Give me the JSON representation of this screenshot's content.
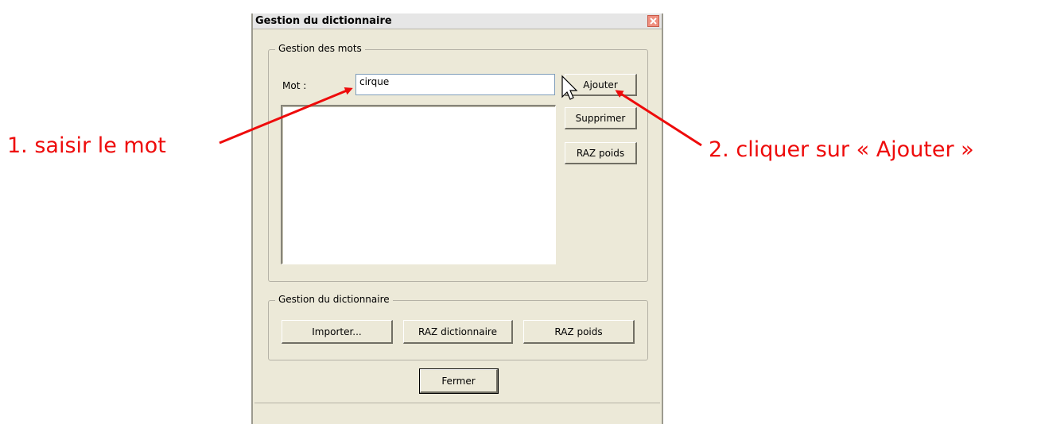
{
  "window": {
    "title": "Gestion du dictionnaire"
  },
  "words_group": {
    "legend": "Gestion des mots",
    "mot_label": "Mot :",
    "mot_value": "cirque",
    "buttons": {
      "add": "Ajouter",
      "delete": "Supprimer",
      "reset_weights": "RAZ poids"
    },
    "word_list": []
  },
  "dictionary_group": {
    "legend": "Gestion du dictionnaire",
    "buttons": {
      "import": "Importer...",
      "reset_dictionary": "RAZ dictionnaire",
      "reset_weights": "RAZ poids"
    }
  },
  "close_button": "Fermer",
  "annotations": {
    "step1": "1. saisir le mot",
    "step2": "2. cliquer sur « Ajouter »",
    "color": "#ee0b0b"
  }
}
